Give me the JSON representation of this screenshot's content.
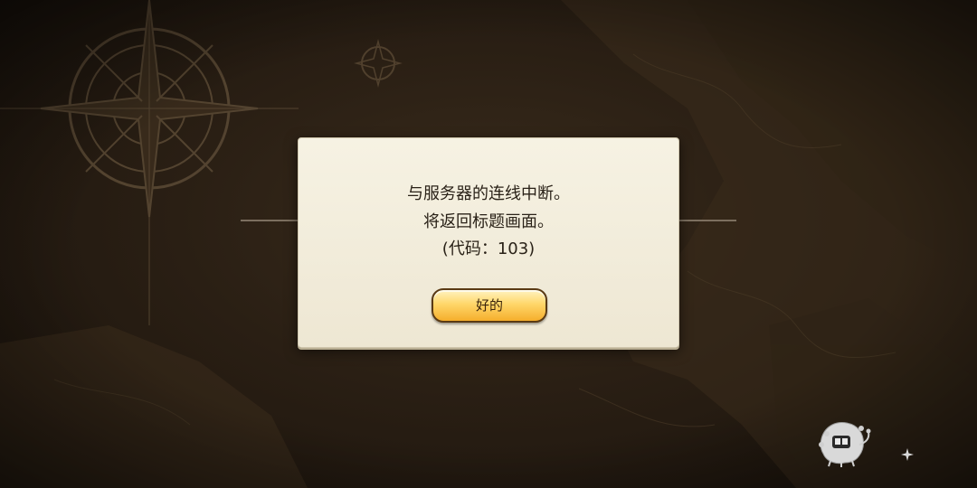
{
  "dialog": {
    "message_line1": "与服务器的连线中断。",
    "message_line2": "将返回标题画面。",
    "message_line3": "(代码：103)",
    "ok_label": "好的"
  },
  "icons": {
    "compass": "compass-rose-icon",
    "mascot": "mascot-creature-icon",
    "sparkle": "sparkle-icon"
  },
  "colors": {
    "background": "#2a1f14",
    "dialog_bg": "#f3eedd",
    "button_top": "#fff3c2",
    "button_bottom": "#f5ae2c",
    "button_border": "#5a3a14",
    "text": "#2a2218"
  }
}
